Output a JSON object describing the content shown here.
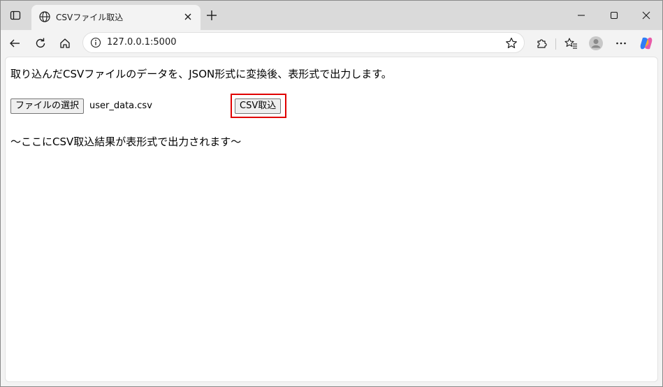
{
  "tab": {
    "title": "CSVファイル取込"
  },
  "address": {
    "url": "127.0.0.1:5000"
  },
  "page": {
    "intro_text": "取り込んだCSVファイルのデータを、JSON形式に変換後、表形式で出力します。",
    "file_button_label": "ファイルの選択",
    "file_name": "user_data.csv",
    "import_button_label": "CSV取込",
    "result_placeholder": "〜ここにCSV取込結果が表形式で出力されます〜"
  },
  "colors": {
    "highlight": "#e00000",
    "tabstrip": "#dadada",
    "toolbar": "#f3f3f3"
  },
  "icons": {
    "tab_actions": "tab-actions-icon",
    "favicon": "globe-icon",
    "tab_close": "close-icon",
    "new_tab": "plus-icon",
    "back": "back-arrow-icon",
    "refresh": "refresh-icon",
    "home": "home-icon",
    "site_info": "info-icon",
    "favorite": "star-icon",
    "extensions": "puzzle-icon",
    "favorites": "favorites-icon",
    "profile": "avatar-icon",
    "more": "more-icon",
    "copilot": "copilot-icon"
  }
}
